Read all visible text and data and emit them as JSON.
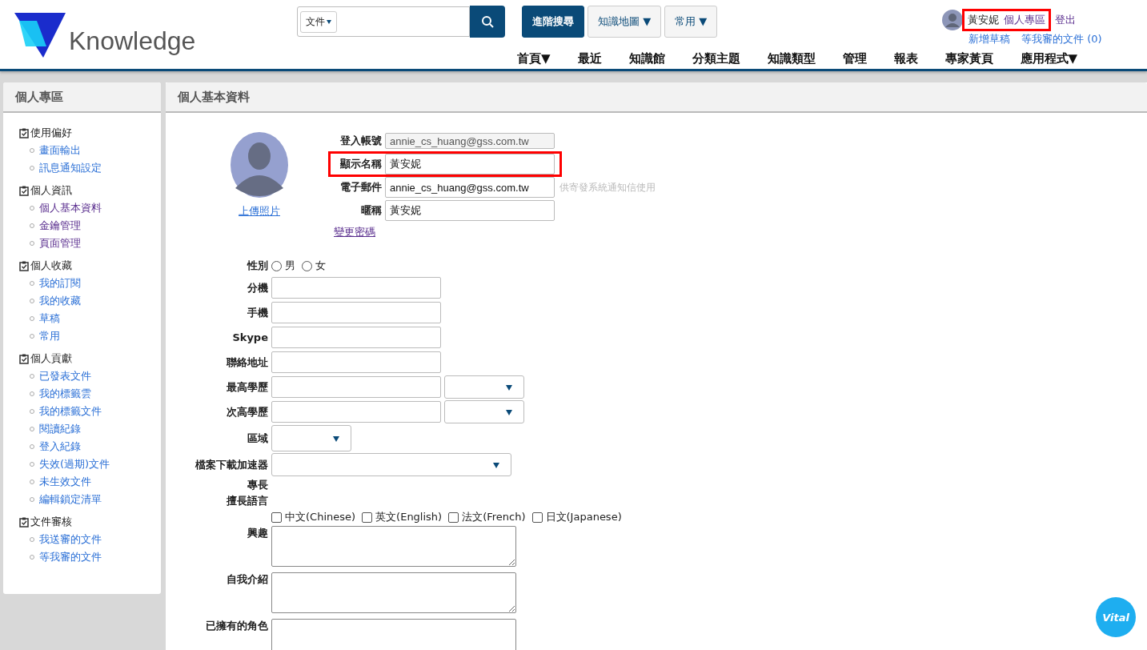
{
  "header": {
    "logo_text": "Knowledge",
    "search": {
      "scope": "文件"
    },
    "buttons": [
      {
        "label": "進階搜尋",
        "kind": "primary"
      },
      {
        "label": "知識地圖 ▼",
        "kind": "plain"
      },
      {
        "label": "常用 ▼",
        "kind": "plain"
      }
    ],
    "user": {
      "name": "黃安妮",
      "links": [
        {
          "label": "個人專區"
        },
        {
          "label": "登出"
        }
      ],
      "highlighted": true,
      "sublinks": [
        "新增草稿",
        "等我審的文件 (0)"
      ]
    },
    "nav": [
      "首頁▼",
      "最近",
      "知識館",
      "分類主題",
      "知識類型",
      "管理",
      "報表",
      "專家黃頁",
      "應用程式▼"
    ]
  },
  "sidebar": {
    "title": "個人專區",
    "groups": [
      {
        "label": "使用偏好",
        "children": [
          {
            "label": "畫面輸出",
            "visited": false
          },
          {
            "label": "訊息通知設定",
            "visited": false
          }
        ]
      },
      {
        "label": "個人資訊",
        "children": [
          {
            "label": "個人基本資料",
            "visited": true
          },
          {
            "label": "金鑰管理",
            "visited": true
          },
          {
            "label": "頁面管理",
            "visited": true
          }
        ]
      },
      {
        "label": "個人收藏",
        "children": [
          {
            "label": "我的訂閱",
            "visited": false
          },
          {
            "label": "我的收藏",
            "visited": false
          },
          {
            "label": "草稿",
            "visited": false
          },
          {
            "label": "常用",
            "visited": false
          }
        ]
      },
      {
        "label": "個人貢獻",
        "children": [
          {
            "label": "已發表文件",
            "visited": false
          },
          {
            "label": "我的標籤雲",
            "visited": false
          },
          {
            "label": "我的標籤文件",
            "visited": false
          },
          {
            "label": "閱讀紀錄",
            "visited": false
          },
          {
            "label": "登入紀錄",
            "visited": false
          },
          {
            "label": "失效(過期)文件",
            "visited": false
          },
          {
            "label": "未生效文件",
            "visited": false
          },
          {
            "label": "編輯鎖定清單",
            "visited": false
          }
        ]
      },
      {
        "label": "文件審核",
        "children": [
          {
            "label": "我送審的文件",
            "visited": false
          },
          {
            "label": "等我審的文件",
            "visited": false
          }
        ]
      }
    ]
  },
  "main": {
    "title": "個人基本資料",
    "upload_photo": "上傳照片",
    "change_password": "變更密碼",
    "account_fields": [
      {
        "label": "登入帳號",
        "value": "annie_cs_huang@gss.com.tw",
        "disabled": true,
        "highlighted": false
      },
      {
        "label": "顯示名稱",
        "value": "黃安妮",
        "disabled": false,
        "highlighted": true
      },
      {
        "label": "電子郵件",
        "value": "annie_cs_huang@gss.com.tw",
        "disabled": false,
        "highlighted": false,
        "hint": "供寄發系統通知信使用"
      },
      {
        "label": "暱稱",
        "value": "黃安妮",
        "disabled": false,
        "highlighted": false
      }
    ],
    "rows": [
      {
        "label": "性別",
        "kind": "radio",
        "options": [
          {
            "label": "男",
            "selected": false
          },
          {
            "label": "女",
            "selected": false
          }
        ]
      },
      {
        "label": "分機",
        "kind": "text"
      },
      {
        "label": "手機",
        "kind": "text"
      },
      {
        "label": "Skype",
        "kind": "text"
      },
      {
        "label": "聯絡地址",
        "kind": "text"
      },
      {
        "label": "最高學歷",
        "kind": "text-select"
      },
      {
        "label": "次高學歷",
        "kind": "text-select"
      },
      {
        "label": "區域",
        "kind": "select"
      },
      {
        "label": "檔案下載加速器",
        "kind": "select-wide"
      },
      {
        "label": "專長",
        "kind": "heading"
      },
      {
        "label": "擅長語言",
        "kind": "checkbox",
        "options": [
          {
            "label": "中文(Chinese)",
            "checked": false
          },
          {
            "label": "英文(English)",
            "checked": false
          },
          {
            "label": "法文(French)",
            "checked": false
          },
          {
            "label": "日文(Japanese)",
            "checked": false
          }
        ]
      },
      {
        "label": "興趣",
        "kind": "textarea"
      },
      {
        "label": "自我介紹",
        "kind": "textarea"
      },
      {
        "label": "已擁有的角色",
        "kind": "textarea"
      }
    ]
  },
  "floating_button": {
    "label": "Vital"
  }
}
